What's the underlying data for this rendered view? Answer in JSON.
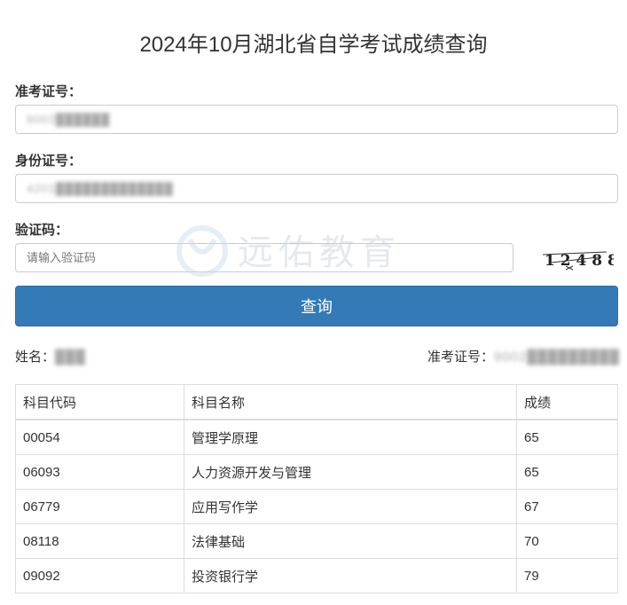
{
  "page": {
    "title": "2024年10月湖北省自学考试成绩查询"
  },
  "form": {
    "ticket_label": "准考证号：",
    "ticket_value": "9002██████",
    "id_label": "身份证号：",
    "id_value": "4201█████████████",
    "captcha_label": "验证码：",
    "captcha_placeholder": "请输入验证码",
    "captcha_image_text": "1 2 4 8 8",
    "submit_label": "查询"
  },
  "watermark": {
    "text": "远佑教育"
  },
  "result": {
    "name_label": "姓名：",
    "name_value": "███",
    "ticket_label": "准考证号：",
    "ticket_value": "9002█████████"
  },
  "table": {
    "headers": [
      "科目代码",
      "科目名称",
      "成绩"
    ],
    "rows": [
      [
        "00054",
        "管理学原理",
        "65"
      ],
      [
        "06093",
        "人力资源开发与管理",
        "65"
      ],
      [
        "06779",
        "应用写作学",
        "67"
      ],
      [
        "08118",
        "法律基础",
        "70"
      ],
      [
        "09092",
        "投资银行学",
        "79"
      ]
    ]
  },
  "colors": {
    "primary": "#337ab7",
    "border": "#dddddd",
    "text": "#333333"
  }
}
